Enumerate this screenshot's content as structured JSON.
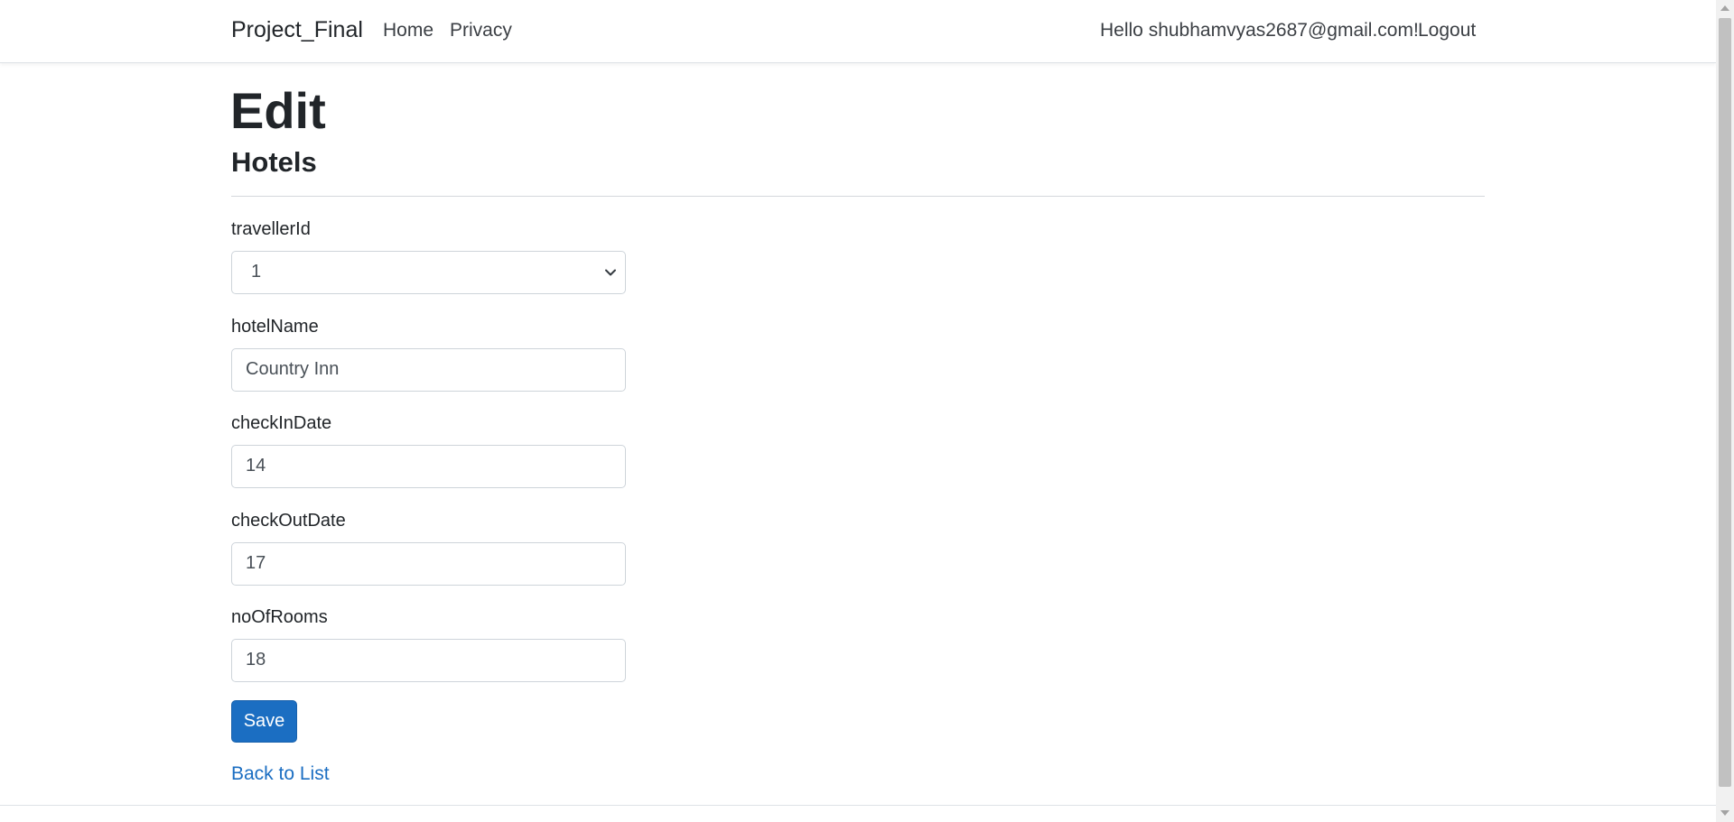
{
  "navbar": {
    "brand": "Project_Final",
    "links": [
      {
        "label": "Home"
      },
      {
        "label": "Privacy"
      }
    ],
    "greeting": "Hello shubhamvyas2687@gmail.com!",
    "logout_label": "Logout"
  },
  "page": {
    "title": "Edit",
    "subtitle": "Hotels"
  },
  "form": {
    "traveller_id": {
      "label": "travellerId",
      "value": "1"
    },
    "hotel_name": {
      "label": "hotelName",
      "value": "Country Inn"
    },
    "check_in_date": {
      "label": "checkInDate",
      "value": "14"
    },
    "check_out_date": {
      "label": "checkOutDate",
      "value": "17"
    },
    "no_of_rooms": {
      "label": "noOfRooms",
      "value": "18"
    },
    "save_label": "Save"
  },
  "back_link_label": "Back to List",
  "colors": {
    "primary": "#1b6ec2",
    "text": "#212529",
    "border": "#ced4da"
  },
  "icons": {
    "select_arrow": "chevron-down-icon"
  }
}
